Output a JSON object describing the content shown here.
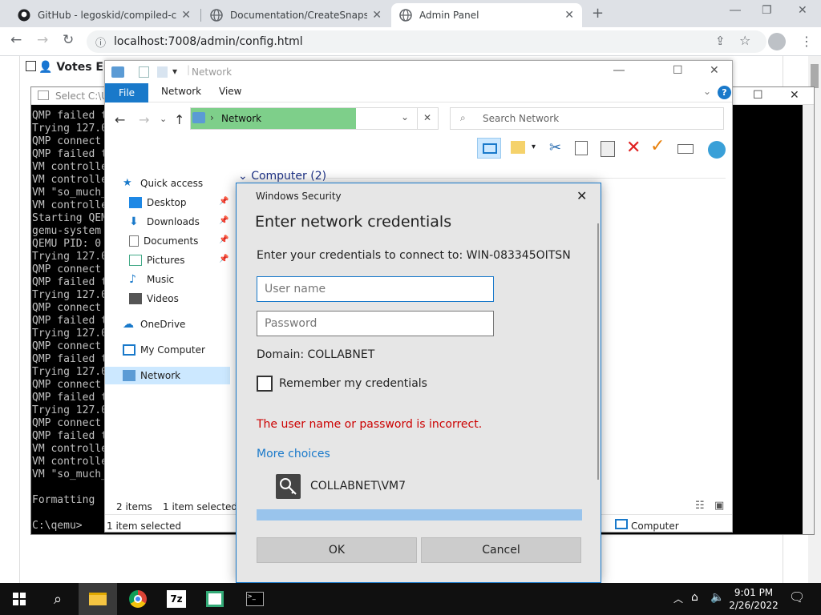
{
  "browser": {
    "tabs": [
      {
        "title": "GitHub - legoskid/compiled-colla",
        "icon": "github-icon"
      },
      {
        "title": "Documentation/CreateSnapshot",
        "icon": "globe-icon"
      },
      {
        "title": "Admin Panel",
        "icon": "globe-icon"
      }
    ],
    "url": "localhost:7008/admin/config.html"
  },
  "page": {
    "votes_label": "Votes Ena"
  },
  "console": {
    "title": "Select C:\\Us",
    "lines": [
      "QMP failed t",
      "Trying 127.0",
      "QMP connect",
      "QMP failed t",
      "VM controlle",
      "VM controlle",
      "VM \"so_much_",
      "VM controlle",
      "Starting QEM",
      "gemu-system",
      "QEMU PID: 0",
      "Trying 127.0",
      "QMP connect",
      "QMP failed t",
      "Trying 127.0",
      "QMP connect",
      "QMP failed t",
      "Trying 127.0",
      "QMP connect",
      "QMP failed t",
      "Trying 127.0",
      "QMP connect",
      "QMP failed t",
      "Trying 127.0",
      "QMP connect",
      "QMP failed t",
      "VM controlle",
      "VM controlle",
      "VM \"so_much_",
      "",
      "Formatting",
      "",
      "C:\\qemu>"
    ]
  },
  "explorer": {
    "title": "Network",
    "ribbon": {
      "file": "File",
      "tabs": [
        "Network",
        "View"
      ]
    },
    "address": "Network",
    "search_placeholder": "Search Network",
    "group_header": "Computer (2)",
    "sidebar": [
      {
        "label": "Quick access",
        "icon": "star-icon"
      },
      {
        "label": "Desktop",
        "icon": "desktop-icon"
      },
      {
        "label": "Downloads",
        "icon": "download-icon"
      },
      {
        "label": "Documents",
        "icon": "document-icon"
      },
      {
        "label": "Pictures",
        "icon": "picture-icon"
      },
      {
        "label": "Music",
        "icon": "music-icon"
      },
      {
        "label": "Videos",
        "icon": "video-icon"
      },
      {
        "label": "OneDrive",
        "icon": "cloud-icon"
      },
      {
        "label": "My Computer",
        "icon": "computer-icon"
      },
      {
        "label": "Network",
        "icon": "network-icon"
      }
    ],
    "status": {
      "items": "2 items",
      "selected": "1 item selected",
      "bottom": "1 item selected",
      "computer": "Computer"
    }
  },
  "dialog": {
    "title": "Windows Security",
    "heading": "Enter network credentials",
    "prompt": "Enter your credentials to connect to: WIN-083345OITSN",
    "username_placeholder": "User name",
    "password_placeholder": "Password",
    "domain": "Domain: COLLABNET",
    "remember": "Remember my credentials",
    "error": "The user name or password is incorrect.",
    "more_choices": "More choices",
    "account": "COLLABNET\\VM7",
    "ok": "OK",
    "cancel": "Cancel",
    "colors": {
      "error": "#cc0000",
      "accent": "#1979ca"
    }
  },
  "taskbar": {
    "time": "9:01 PM",
    "date": "2/26/2022"
  }
}
